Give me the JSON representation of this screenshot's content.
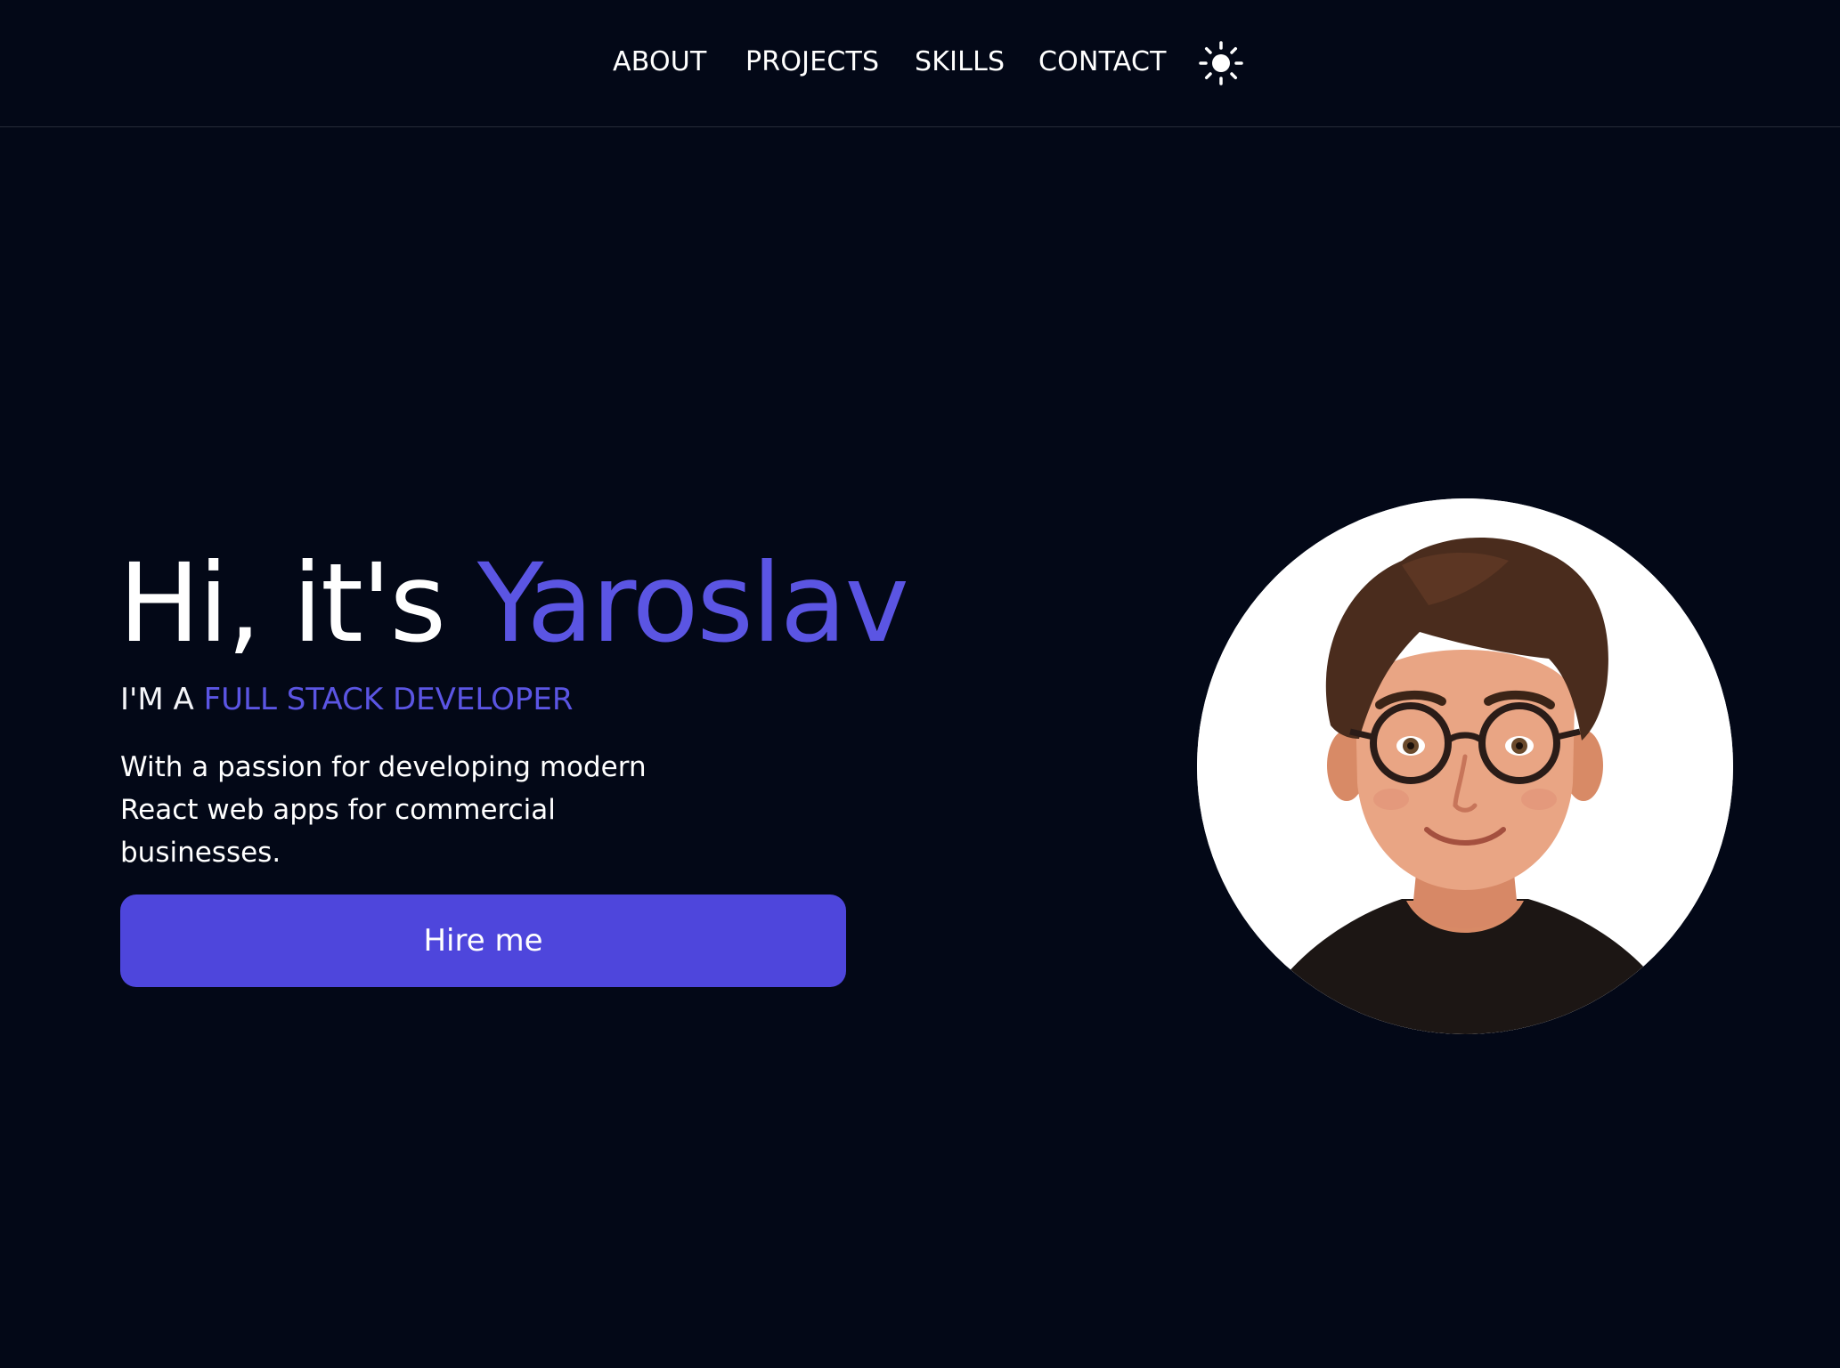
{
  "nav": {
    "items": [
      {
        "label": "ABOUT"
      },
      {
        "label": "PROJECTS"
      },
      {
        "label": "SKILLS"
      },
      {
        "label": "CONTACT"
      }
    ],
    "theme_icon": "sun-icon"
  },
  "hero": {
    "title_prefix": "Hi, it's ",
    "title_name": "Yaroslav",
    "subtitle_prefix": "I'M A ",
    "subtitle_role": "FULL STACK DEVELOPER",
    "description": "With a passion for developing modern React web apps for commercial businesses.",
    "button_label": "Hire me"
  },
  "colors": {
    "background": "#030817",
    "accent": "#5b55e3",
    "button": "#4e46dc",
    "text": "#ffffff"
  }
}
